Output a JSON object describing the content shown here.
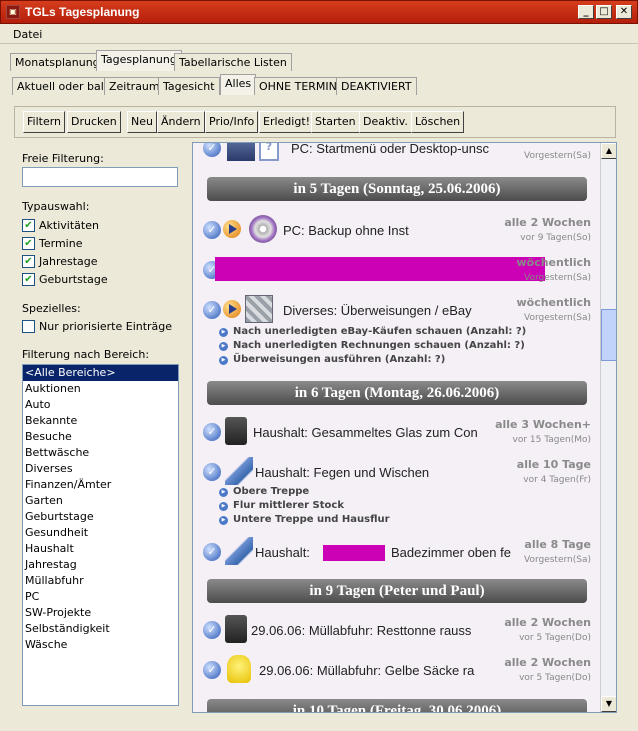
{
  "window": {
    "title": "TGLs Tagesplanung"
  },
  "menu": {
    "datei": "Datei"
  },
  "tabs_top": [
    "Monatsplanung",
    "Tagesplanung",
    "Tabellarische Listen"
  ],
  "tabs_sub": [
    "Aktuell oder bald",
    "Zeitraum",
    "Tagesicht",
    "Alles",
    "OHNE TERMIN",
    "DEAKTIVIERT"
  ],
  "toolbar": {
    "filtern": "Filtern",
    "drucken": "Drucken",
    "neu": "Neu",
    "aendern": "Ändern",
    "prio": "Prio/Info",
    "erledigt": "Erledigt!",
    "starten": "Starten",
    "deaktiv": "Deaktiv.",
    "loeschen": "Löschen"
  },
  "filter": {
    "freie_label": "Freie Filterung:",
    "freie_value": "",
    "typ_label": "Typauswahl:",
    "typ": [
      {
        "label": "Aktivitäten",
        "checked": true
      },
      {
        "label": "Termine",
        "checked": true
      },
      {
        "label": "Jahrestage",
        "checked": true
      },
      {
        "label": "Geburtstage",
        "checked": true
      }
    ],
    "spezielles_label": "Spezielles:",
    "prio_label": "Nur priorisierte Einträge",
    "prio_checked": false,
    "bereich_label": "Filterung nach Bereich:",
    "bereiche": [
      "<Alle Bereiche>",
      "Auktionen",
      "Auto",
      "Bekannte",
      "Besuche",
      "Bettwäsche",
      "Diverses",
      "Finanzen/Ämter",
      "Garten",
      "Geburtstage",
      "Gesundheit",
      "Haushalt",
      "Jahrestag",
      "Müllabfuhr",
      "PC",
      "SW-Projekte",
      "Selbständigkeit",
      "Wäsche"
    ],
    "selected_bereich": "<Alle Bereiche>"
  },
  "planner": {
    "e0": {
      "text": "PC: Startmenü oder Desktop-unsc",
      "when": "Vorgestern(Sa)"
    },
    "h1": "in 5 Tagen  (Sonntag, 25.06.2006)",
    "e1": {
      "text": "PC: Backup ohne Inst",
      "freq": "alle 2 Wochen",
      "when": "vor 9 Tagen(So)"
    },
    "e2": {
      "freq": "wöchentlich",
      "when": "Vorgestern(Sa)"
    },
    "e3": {
      "text": "Diverses: Überweisungen / eBay",
      "freq": "wöchentlich",
      "when": "Vorgestern(Sa)",
      "subs": [
        "Nach unerledigten eBay-Käufen schauen (Anzahl: ?)",
        "Nach unerledigten Rechnungen schauen (Anzahl: ?)",
        "Überweisungen ausführen (Anzahl: ?)"
      ]
    },
    "h2": "in 6 Tagen  (Montag, 26.06.2006)",
    "e4": {
      "text": "Haushalt: Gesammeltes Glas zum Con",
      "freq": "alle 3 Wochen+",
      "when": "vor 15 Tagen(Mo)"
    },
    "e5": {
      "text": "Haushalt: Fegen und Wischen",
      "freq": "alle 10 Tage",
      "when": "vor 4 Tagen(Fr)",
      "subs": [
        "Obere Treppe",
        "Flur mittlerer Stock",
        "Untere Treppe und Hausflur"
      ]
    },
    "e6": {
      "text_a": "Haushalt:",
      "text_b": "Badezimmer oben fe",
      "freq": "alle 8 Tage",
      "when": "Vorgestern(Sa)"
    },
    "h3": "in 9 Tagen  (Peter und Paul)",
    "e7": {
      "text": "29.06.06: Müllabfuhr: Resttonne rauss",
      "freq": "alle 2 Wochen",
      "when": "vor 5 Tagen(Do)"
    },
    "e8": {
      "text": "29.06.06: Müllabfuhr: Gelbe Säcke ra",
      "freq": "alle 2 Wochen",
      "when": "vor 5 Tagen(Do)"
    },
    "h4": "in 10 Tagen  (Freitag, 30.06.2006)"
  }
}
